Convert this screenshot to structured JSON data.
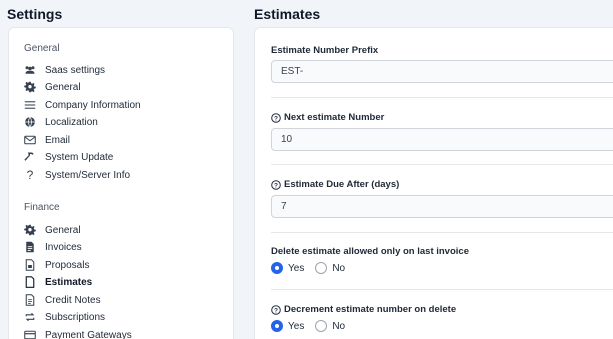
{
  "headers": {
    "settings": "Settings",
    "estimates": "Estimates"
  },
  "sidebar": {
    "groups": [
      {
        "title": "General",
        "items": [
          {
            "label": "Saas settings",
            "icon": "users-icon"
          },
          {
            "label": "General",
            "icon": "gear-icon"
          },
          {
            "label": "Company Information",
            "icon": "bars-icon"
          },
          {
            "label": "Localization",
            "icon": "globe-icon"
          },
          {
            "label": "Email",
            "icon": "envelope-icon"
          },
          {
            "label": "System Update",
            "icon": "hammer-icon"
          },
          {
            "label": "System/Server Info",
            "icon": "question-icon"
          }
        ]
      },
      {
        "title": "Finance",
        "items": [
          {
            "label": "General",
            "icon": "gear-icon"
          },
          {
            "label": "Invoices",
            "icon": "file-invoice-icon"
          },
          {
            "label": "Proposals",
            "icon": "file-text-icon"
          },
          {
            "label": "Estimates",
            "icon": "file-icon",
            "active": true
          },
          {
            "label": "Credit Notes",
            "icon": "file-lines-icon"
          },
          {
            "label": "Subscriptions",
            "icon": "repeat-icon"
          },
          {
            "label": "Payment Gateways",
            "icon": "credit-card-icon"
          }
        ]
      }
    ]
  },
  "form": {
    "prefix": {
      "label": "Estimate Number Prefix",
      "value": "EST-"
    },
    "next_number": {
      "label": "Next estimate Number",
      "value": "10"
    },
    "due_after": {
      "label": "Estimate Due After (days)",
      "value": "7"
    },
    "delete_last": {
      "label": "Delete estimate allowed only on last invoice",
      "yes": "Yes",
      "no": "No",
      "selected": "Yes"
    },
    "decrement": {
      "label": "Decrement estimate number on delete",
      "yes": "Yes",
      "no": "No",
      "selected": "Yes"
    }
  },
  "colors": {
    "accent": "#2563eb",
    "background": "#f1f5f9"
  }
}
